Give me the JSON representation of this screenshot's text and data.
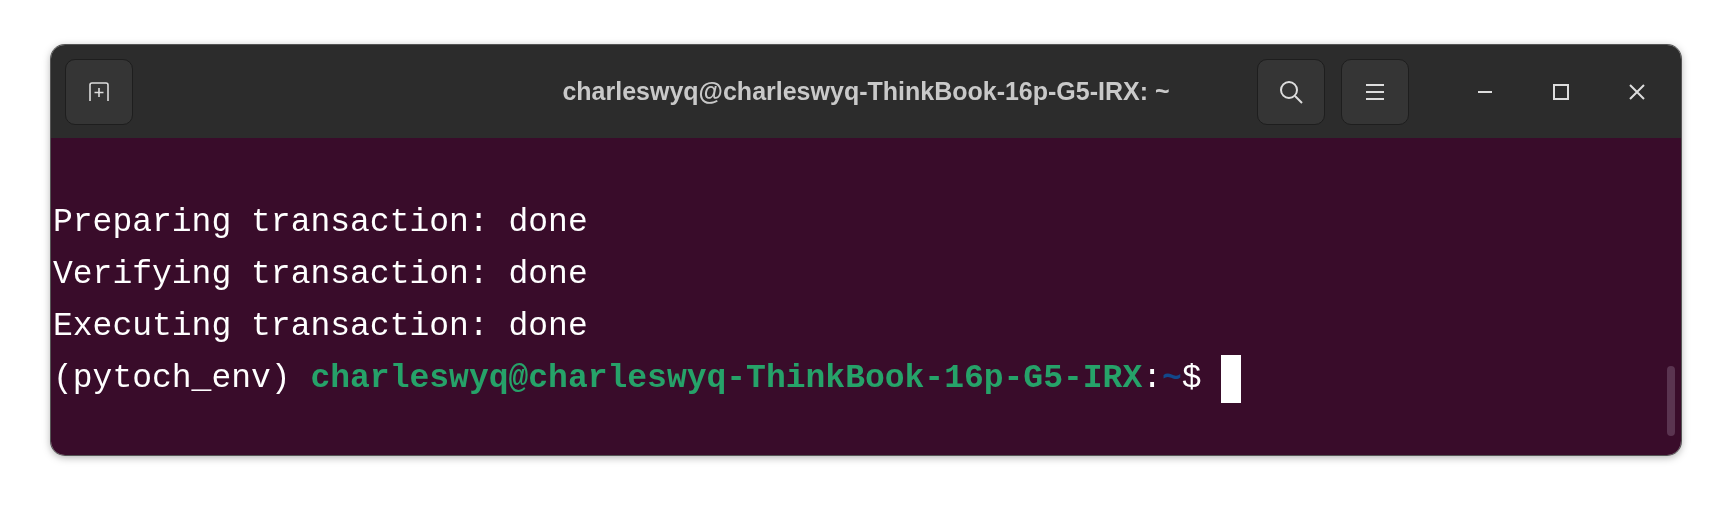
{
  "window": {
    "title": "charleswyq@charleswyq-ThinkBook-16p-G5-IRX: ~"
  },
  "terminal": {
    "lines": [
      {
        "segments": [
          {
            "kind": "plain",
            "text": "Preparing transaction: done"
          }
        ]
      },
      {
        "segments": [
          {
            "kind": "plain",
            "text": "Verifying transaction: done"
          }
        ]
      },
      {
        "segments": [
          {
            "kind": "plain",
            "text": "Executing transaction: done"
          }
        ]
      },
      {
        "segments": [
          {
            "kind": "plain",
            "text": "(pytoch_env) "
          },
          {
            "kind": "user_host",
            "text": "charleswyq@charleswyq-ThinkBook-16p-G5-IRX"
          },
          {
            "kind": "plain",
            "text": ":"
          },
          {
            "kind": "path",
            "text": "~"
          },
          {
            "kind": "plain",
            "text": "$ "
          }
        ],
        "cursor": true
      }
    ]
  }
}
